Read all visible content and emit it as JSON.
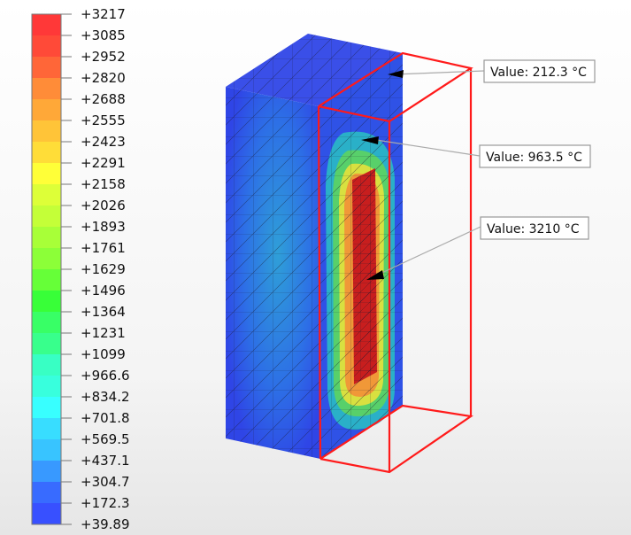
{
  "legend": {
    "labels": [
      "+3217",
      "+3085",
      "+2952",
      "+2820",
      "+2688",
      "+2555",
      "+2423",
      "+2291",
      "+2158",
      "+2026",
      "+1893",
      "+1761",
      "+1629",
      "+1496",
      "+1364",
      "+1231",
      "+1099",
      "+966.6",
      "+834.2",
      "+701.8",
      "+569.5",
      "+437.1",
      "+304.7",
      "+172.3",
      "+39.89"
    ],
    "colors": [
      "#ff3838",
      "#ff4a38",
      "#ff6638",
      "#ff8c38",
      "#ffa838",
      "#ffc438",
      "#ffdd38",
      "#ffff38",
      "#ddff38",
      "#c4ff38",
      "#a8ff38",
      "#8cff38",
      "#66ff38",
      "#38ff38",
      "#38ff66",
      "#38ff8c",
      "#38ffc4",
      "#38ffdd",
      "#38ffff",
      "#38ddff",
      "#38c4ff",
      "#3899ff",
      "#386bff",
      "#3850ff"
    ]
  },
  "callouts": [
    {
      "text": "Value: 212.3 °C"
    },
    {
      "text": "Value: 963.5 °C"
    },
    {
      "text": "Value: 3210 °C"
    }
  ],
  "colors": {
    "outline": "#ff1a1a",
    "hot": "#c81e1e",
    "cold": "#2f3fe0"
  }
}
